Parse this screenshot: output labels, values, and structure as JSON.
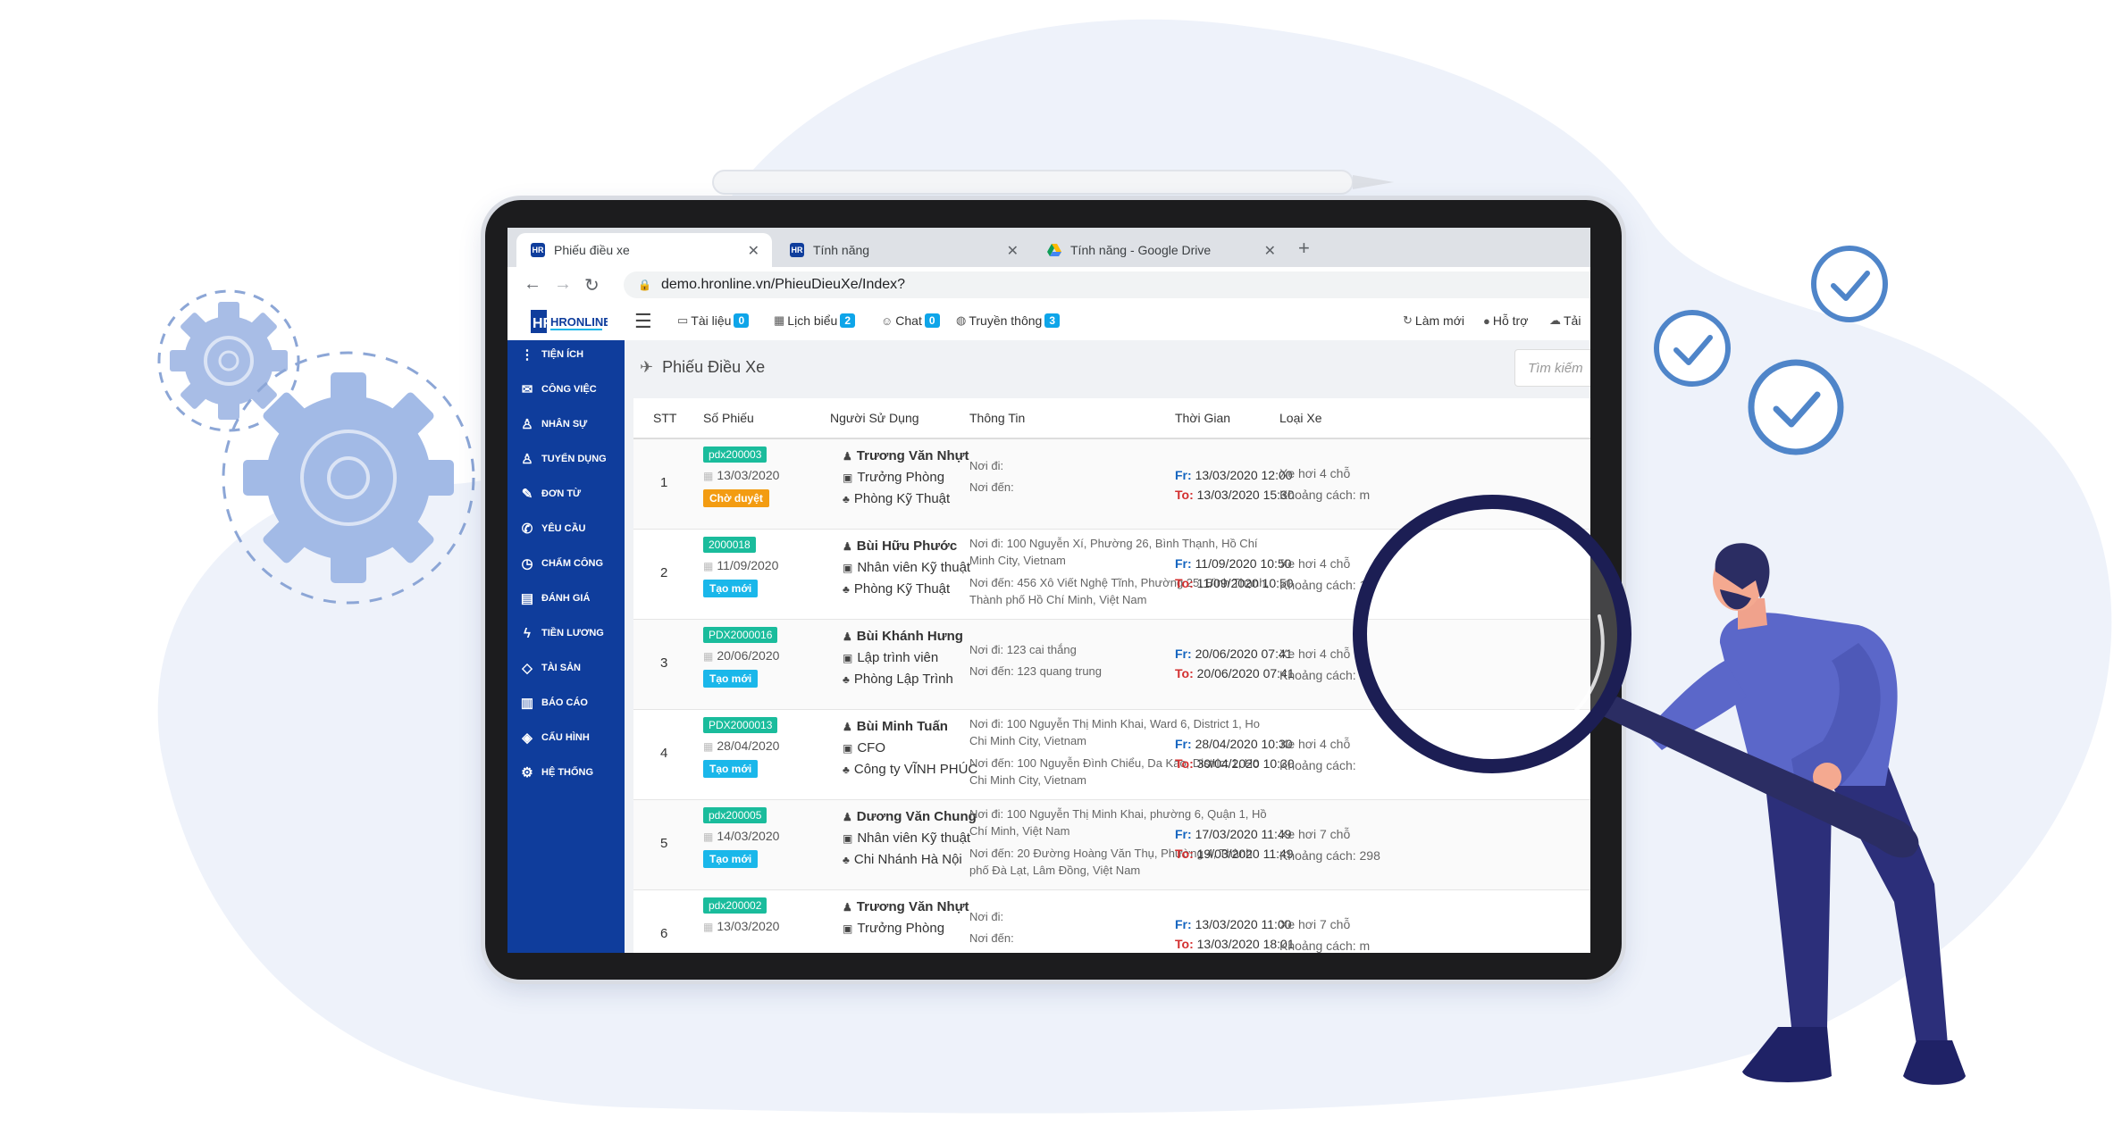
{
  "browser": {
    "tabs": [
      {
        "title": "Phiếu điều xe",
        "icon": "hr-favicon",
        "active": true
      },
      {
        "title": "Tính năng",
        "icon": "hr-favicon",
        "active": false
      },
      {
        "title": "Tính năng - Google Drive",
        "icon": "google-drive-icon",
        "active": false
      }
    ],
    "new_tab": "+",
    "url": "demo.hronline.vn/PhieuDieuXe/Index?"
  },
  "app": {
    "logo_text": "HRONLINE",
    "menu": [
      {
        "label": "Tài liệu",
        "count": "0",
        "icon": "folder-icon"
      },
      {
        "label": "Lịch biểu",
        "count": "2",
        "icon": "calendar-icon"
      },
      {
        "label": "Chat",
        "count": "0",
        "icon": "chat-icon"
      },
      {
        "label": "Truyền thông",
        "count": "3",
        "icon": "globe-icon"
      }
    ],
    "actions": [
      {
        "label": "Làm mới",
        "icon": "refresh-icon"
      },
      {
        "label": "Hỗ trợ",
        "icon": "help-icon"
      },
      {
        "label": "Tải",
        "icon": "cloud-icon"
      }
    ]
  },
  "sidebar": {
    "items": [
      {
        "label": "TIỆN ÍCH",
        "icon": "more-vertical-icon"
      },
      {
        "label": "CÔNG VIỆC",
        "icon": "envelope-icon"
      },
      {
        "label": "NHÂN SỰ",
        "icon": "user-icon"
      },
      {
        "label": "TUYỂN DỤNG",
        "icon": "user-plus-icon"
      },
      {
        "label": "ĐƠN TỪ",
        "icon": "edit-icon"
      },
      {
        "label": "YÊU CẦU",
        "icon": "phone-icon"
      },
      {
        "label": "CHẤM CÔNG",
        "icon": "clock-icon"
      },
      {
        "label": "ĐÁNH GIÁ",
        "icon": "book-icon"
      },
      {
        "label": "TIỀN LƯƠNG",
        "icon": "bolt-icon"
      },
      {
        "label": "TÀI SẢN",
        "icon": "diamond-icon"
      },
      {
        "label": "BÁO CÁO",
        "icon": "bar-chart-icon"
      },
      {
        "label": "CẤU HÌNH",
        "icon": "layers-icon"
      },
      {
        "label": "HỆ THỐNG",
        "icon": "cogs-icon"
      }
    ]
  },
  "page": {
    "title": "Phiếu Điều Xe",
    "search_placeholder": "Tìm kiếm"
  },
  "table": {
    "headers": [
      "STT",
      "Số Phiếu",
      "Người Sử Dụng",
      "Thông Tin",
      "Thời Gian",
      "Loại Xe"
    ],
    "rows": [
      {
        "stt": "1",
        "code": "pdx200003",
        "date": "13/03/2020",
        "status": "Chờ duyệt",
        "status_type": "wait",
        "user": "Trương Văn Nhựt",
        "position": "Trưởng Phòng",
        "dept": "Phòng Kỹ Thuật",
        "from_place": "Nơi đi:",
        "to_place": "Nơi đến:",
        "from_time": "13/03/2020 12:00",
        "to_time": "13/03/2020 15:30",
        "car": "Xe hơi 4 chỗ",
        "distance": "Khoảng cách: m"
      },
      {
        "stt": "2",
        "code": "2000018",
        "date": "11/09/2020",
        "status": "Tạo mới",
        "status_type": "new",
        "user": "Bùi Hữu Phước",
        "position": "Nhân viên Kỹ thuật",
        "dept": "Phòng Kỹ Thuật",
        "from_place": "Nơi đi: 100 Nguyễn Xí, Phường 26, Bình Thạnh, Hồ Chí Minh City, Vietnam",
        "to_place": "Nơi đến: 456 Xô Viết Nghệ Tĩnh, Phường 25, Bình Thạnh, Thành phố Hồ Chí Minh, Việt Nam",
        "from_time": "11/09/2020 10:50",
        "to_time": "11/09/2020 10:50",
        "car": "Xe hơi 4 chỗ",
        "distance": "Khoảng cách: 1,6"
      },
      {
        "stt": "3",
        "code": "PDX2000016",
        "date": "20/06/2020",
        "status": "Tạo mới",
        "status_type": "new",
        "user": "Bùi Khánh Hưng",
        "position": "Lập trình viên",
        "dept": "Phòng Lập Trình",
        "from_place": "Nơi đi: 123 cai thắng",
        "to_place": "Nơi đến: 123 quang trung",
        "from_time": "20/06/2020 07:41",
        "to_time": "20/06/2020 07:41",
        "car": "Xe hơi 4 chỗ",
        "distance": "Khoảng cách: m"
      },
      {
        "stt": "4",
        "code": "PDX2000013",
        "date": "28/04/2020",
        "status": "Tạo mới",
        "status_type": "new",
        "user": "Bùi Minh Tuấn",
        "position": "CFO",
        "dept": "Công ty VĨNH PHÚC",
        "from_place": "Nơi đi: 100 Nguyễn Thị Minh Khai, Ward 6, District 1, Ho Chi Minh City, Vietnam",
        "to_place": "Nơi đến: 100 Nguyễn Đình Chiểu, Da Kao, District 1, Ho Chi Minh City, Vietnam",
        "from_time": "28/04/2020 10:30",
        "to_time": "30/04/2020 10:30",
        "car": "Xe hơi 4 chỗ",
        "distance": "Khoảng cách:"
      },
      {
        "stt": "5",
        "code": "pdx200005",
        "date": "14/03/2020",
        "status": "Tạo mới",
        "status_type": "new",
        "user": "Dương Văn Chung",
        "position": "Nhân viên Kỹ thuật",
        "dept": "Chi Nhánh Hà Nội",
        "from_place": "Nơi đi: 100 Nguyễn Thị Minh Khai, phường 6, Quận 1, Hồ Chí Minh, Việt Nam",
        "to_place": "Nơi đến: 20 Đường Hoàng Văn Thụ, Phường 4, Thành phố Đà Lạt, Lâm Đồng, Việt Nam",
        "from_time": "17/03/2020 11:49",
        "to_time": "19/03/2020 11:49",
        "car": "Xe hơi 7 chỗ",
        "distance": "Khoảng cách: 298"
      },
      {
        "stt": "6",
        "code": "pdx200002",
        "date": "13/03/2020",
        "status": "",
        "status_type": "none",
        "user": "Trương Văn Nhựt",
        "position": "Trưởng Phòng",
        "dept": "",
        "from_place": "Nơi đi:",
        "to_place": "Nơi đến:",
        "from_time": "13/03/2020 11:00",
        "to_time": "13/03/2020 18:01",
        "car": "Xe hơi 7 chỗ",
        "distance": "Khoảng cách: m"
      }
    ],
    "fr_label": "Fr:",
    "to_label": "To:"
  },
  "colors": {
    "sidebar": "#0f3d9c",
    "status_wait": "#f39c12",
    "status_new": "#1ab7ea",
    "code_pill": "#1abc9c",
    "illustration_blue": "#4f85c9",
    "gear": "#9eb6e3",
    "background_blob": "#eef2fa"
  }
}
